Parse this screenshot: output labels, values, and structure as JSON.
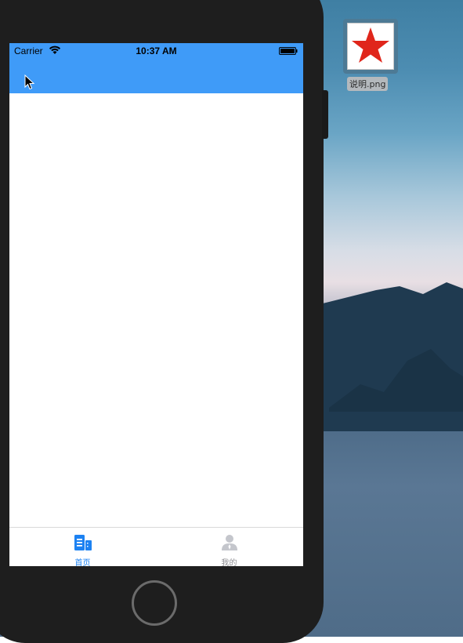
{
  "status_bar": {
    "carrier": "Carrier",
    "time": "10:37 AM",
    "wifi_icon": "wifi-icon",
    "battery_icon": "battery-icon"
  },
  "tab_bar": {
    "tabs": [
      {
        "label": "首页",
        "icon": "home-document-icon",
        "selected": true
      },
      {
        "label": "我的",
        "icon": "person-icon",
        "selected": false
      }
    ]
  },
  "desktop": {
    "file_name": "说明.png",
    "file_icon": "red-star-icon"
  },
  "colors": {
    "nav_blue": "#3f9bf8",
    "tab_active": "#1d82f2",
    "tab_inactive": "#8e8e93",
    "star_red": "#e0261b"
  }
}
